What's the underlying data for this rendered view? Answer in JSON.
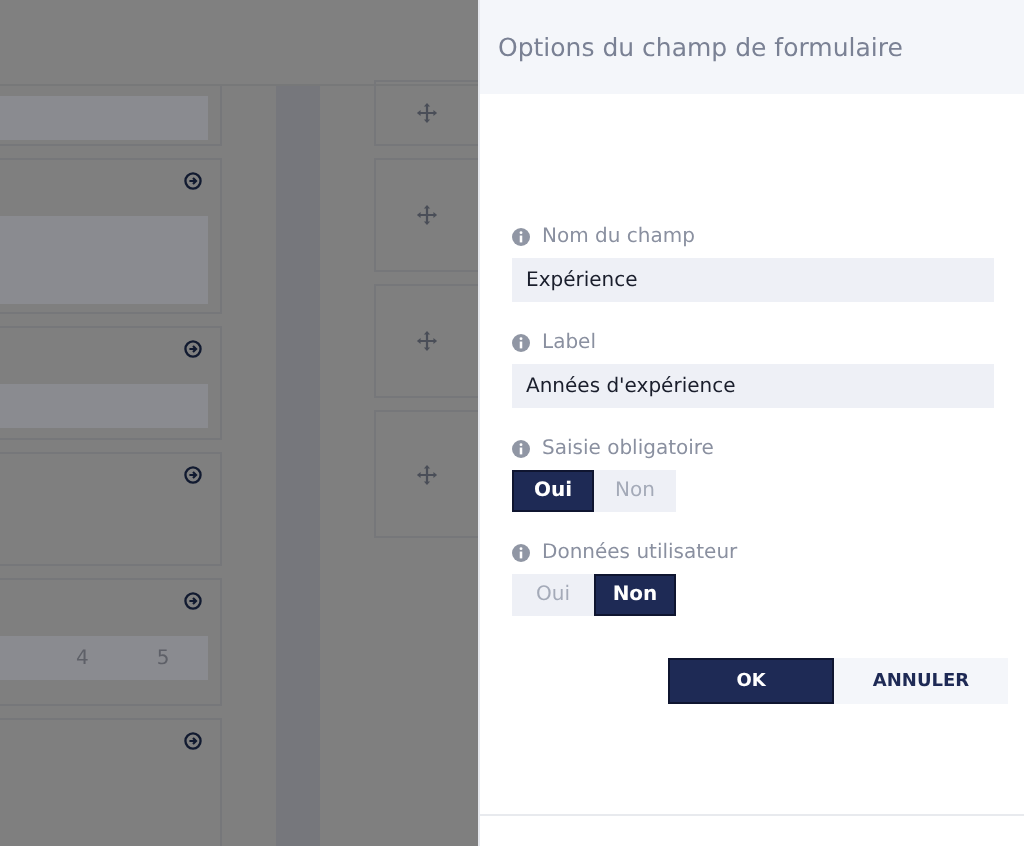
{
  "background": {
    "scale_labels": [
      "4",
      "5"
    ]
  },
  "panel": {
    "title": "Options du champ de formulaire",
    "fields": [
      {
        "kind": "text",
        "label": "Nom du champ",
        "value": "Expérience"
      },
      {
        "kind": "text",
        "label": "Label",
        "value": "Années d'expérience"
      },
      {
        "kind": "toggle",
        "label": "Saisie obligatoire",
        "options": [
          {
            "label": "Oui",
            "selected": true
          },
          {
            "label": "Non",
            "selected": false
          }
        ]
      },
      {
        "kind": "toggle",
        "label": "Données utilisateur",
        "options": [
          {
            "label": "Oui",
            "selected": false
          },
          {
            "label": "Non",
            "selected": true
          }
        ]
      }
    ],
    "buttons": [
      {
        "label": "OK",
        "kind": "primary"
      },
      {
        "label": "ANNULER",
        "kind": "secondary"
      }
    ]
  }
}
